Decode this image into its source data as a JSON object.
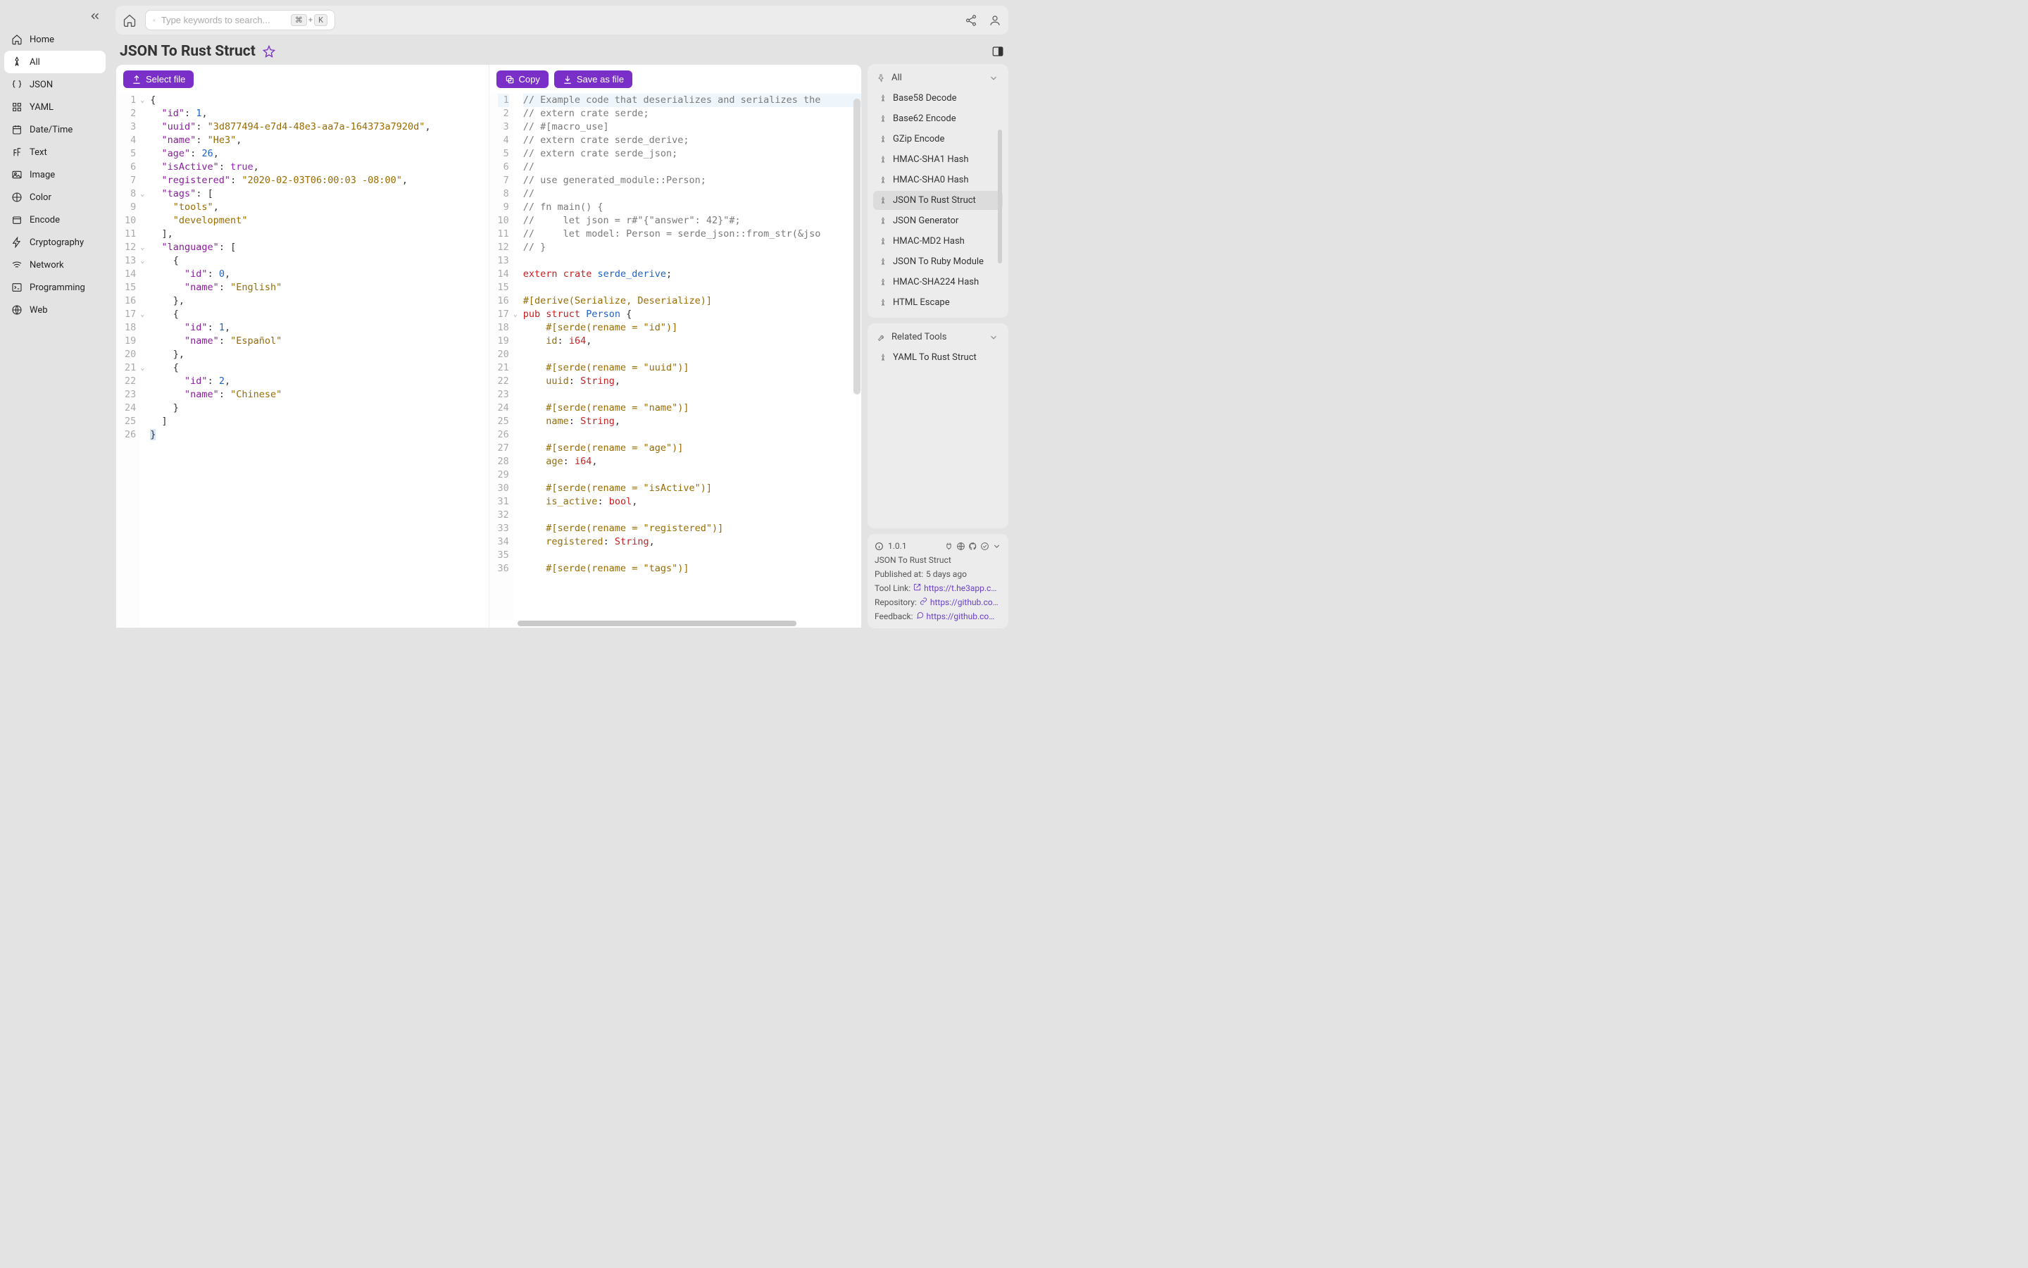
{
  "sidebar": {
    "items": [
      {
        "icon": "home",
        "label": "Home"
      },
      {
        "icon": "pin",
        "label": "All",
        "active": true
      },
      {
        "icon": "braces",
        "label": "JSON"
      },
      {
        "icon": "grid",
        "label": "YAML"
      },
      {
        "icon": "calendar",
        "label": "Date/Time"
      },
      {
        "icon": "font",
        "label": "Text"
      },
      {
        "icon": "image",
        "label": "Image"
      },
      {
        "icon": "palette",
        "label": "Color"
      },
      {
        "icon": "box",
        "label": "Encode"
      },
      {
        "icon": "bolt",
        "label": "Cryptography"
      },
      {
        "icon": "wifi",
        "label": "Network"
      },
      {
        "icon": "terminal",
        "label": "Programming"
      },
      {
        "icon": "globe",
        "label": "Web"
      }
    ]
  },
  "search": {
    "placeholder": "Type keywords to search...",
    "kbd1": "⌘",
    "plus": "+",
    "kbd2": "K"
  },
  "title": "JSON To Rust Struct",
  "left_toolbar": {
    "select_file": "Select file"
  },
  "right_toolbar": {
    "copy": "Copy",
    "save_as": "Save as file"
  },
  "input_json": [
    {
      "n": 1,
      "fold": "v",
      "tokens": [
        {
          "t": "{",
          "c": "p",
          "hl": true
        }
      ]
    },
    {
      "n": 2,
      "tokens": [
        {
          "t": "  ",
          "c": "p"
        },
        {
          "t": "\"id\"",
          "c": "k"
        },
        {
          "t": ": ",
          "c": "p"
        },
        {
          "t": "1",
          "c": "n"
        },
        {
          "t": ",",
          "c": "p"
        }
      ]
    },
    {
      "n": 3,
      "tokens": [
        {
          "t": "  ",
          "c": "p"
        },
        {
          "t": "\"uuid\"",
          "c": "k"
        },
        {
          "t": ": ",
          "c": "p"
        },
        {
          "t": "\"3d877494-e7d4-48e3-aa7a-164373a7920d\"",
          "c": "s"
        },
        {
          "t": ",",
          "c": "p"
        }
      ]
    },
    {
      "n": 4,
      "tokens": [
        {
          "t": "  ",
          "c": "p"
        },
        {
          "t": "\"name\"",
          "c": "k"
        },
        {
          "t": ": ",
          "c": "p"
        },
        {
          "t": "\"He3\"",
          "c": "s"
        },
        {
          "t": ",",
          "c": "p"
        }
      ]
    },
    {
      "n": 5,
      "tokens": [
        {
          "t": "  ",
          "c": "p"
        },
        {
          "t": "\"age\"",
          "c": "k"
        },
        {
          "t": ": ",
          "c": "p"
        },
        {
          "t": "26",
          "c": "n"
        },
        {
          "t": ",",
          "c": "p"
        }
      ]
    },
    {
      "n": 6,
      "tokens": [
        {
          "t": "  ",
          "c": "p"
        },
        {
          "t": "\"isActive\"",
          "c": "k"
        },
        {
          "t": ": ",
          "c": "p"
        },
        {
          "t": "true",
          "c": "b"
        },
        {
          "t": ",",
          "c": "p"
        }
      ]
    },
    {
      "n": 7,
      "tokens": [
        {
          "t": "  ",
          "c": "p"
        },
        {
          "t": "\"registered\"",
          "c": "k"
        },
        {
          "t": ": ",
          "c": "p"
        },
        {
          "t": "\"2020-02-03T06:00:03 -08:00\"",
          "c": "s"
        },
        {
          "t": ",",
          "c": "p"
        }
      ]
    },
    {
      "n": 8,
      "fold": "v",
      "tokens": [
        {
          "t": "  ",
          "c": "p"
        },
        {
          "t": "\"tags\"",
          "c": "k"
        },
        {
          "t": ": [",
          "c": "p"
        }
      ]
    },
    {
      "n": 9,
      "tokens": [
        {
          "t": "    ",
          "c": "p"
        },
        {
          "t": "\"tools\"",
          "c": "s"
        },
        {
          "t": ",",
          "c": "p"
        }
      ]
    },
    {
      "n": 10,
      "tokens": [
        {
          "t": "    ",
          "c": "p"
        },
        {
          "t": "\"development\"",
          "c": "s"
        }
      ]
    },
    {
      "n": 11,
      "tokens": [
        {
          "t": "  ],",
          "c": "p"
        }
      ]
    },
    {
      "n": 12,
      "fold": "v",
      "tokens": [
        {
          "t": "  ",
          "c": "p"
        },
        {
          "t": "\"language\"",
          "c": "k"
        },
        {
          "t": ": [",
          "c": "p"
        }
      ]
    },
    {
      "n": 13,
      "fold": "v",
      "tokens": [
        {
          "t": "    {",
          "c": "p"
        }
      ]
    },
    {
      "n": 14,
      "tokens": [
        {
          "t": "      ",
          "c": "p"
        },
        {
          "t": "\"id\"",
          "c": "k"
        },
        {
          "t": ": ",
          "c": "p"
        },
        {
          "t": "0",
          "c": "n"
        },
        {
          "t": ",",
          "c": "p"
        }
      ]
    },
    {
      "n": 15,
      "tokens": [
        {
          "t": "      ",
          "c": "p"
        },
        {
          "t": "\"name\"",
          "c": "k"
        },
        {
          "t": ": ",
          "c": "p"
        },
        {
          "t": "\"English\"",
          "c": "s"
        }
      ]
    },
    {
      "n": 16,
      "tokens": [
        {
          "t": "    },",
          "c": "p"
        }
      ]
    },
    {
      "n": 17,
      "fold": "v",
      "tokens": [
        {
          "t": "    {",
          "c": "p"
        }
      ]
    },
    {
      "n": 18,
      "tokens": [
        {
          "t": "      ",
          "c": "p"
        },
        {
          "t": "\"id\"",
          "c": "k"
        },
        {
          "t": ": ",
          "c": "p"
        },
        {
          "t": "1",
          "c": "n"
        },
        {
          "t": ",",
          "c": "p"
        }
      ]
    },
    {
      "n": 19,
      "tokens": [
        {
          "t": "      ",
          "c": "p"
        },
        {
          "t": "\"name\"",
          "c": "k"
        },
        {
          "t": ": ",
          "c": "p"
        },
        {
          "t": "\"Español\"",
          "c": "s"
        }
      ]
    },
    {
      "n": 20,
      "tokens": [
        {
          "t": "    },",
          "c": "p"
        }
      ]
    },
    {
      "n": 21,
      "fold": "v",
      "tokens": [
        {
          "t": "    {",
          "c": "p"
        }
      ]
    },
    {
      "n": 22,
      "tokens": [
        {
          "t": "      ",
          "c": "p"
        },
        {
          "t": "\"id\"",
          "c": "k"
        },
        {
          "t": ": ",
          "c": "p"
        },
        {
          "t": "2",
          "c": "n"
        },
        {
          "t": ",",
          "c": "p"
        }
      ]
    },
    {
      "n": 23,
      "tokens": [
        {
          "t": "      ",
          "c": "p"
        },
        {
          "t": "\"name\"",
          "c": "k"
        },
        {
          "t": ": ",
          "c": "p"
        },
        {
          "t": "\"Chinese\"",
          "c": "s"
        }
      ]
    },
    {
      "n": 24,
      "tokens": [
        {
          "t": "    }",
          "c": "p"
        }
      ]
    },
    {
      "n": 25,
      "tokens": [
        {
          "t": "  ]",
          "c": "p"
        }
      ]
    },
    {
      "n": 26,
      "tokens": [
        {
          "t": "}",
          "c": "p",
          "hlbox": true
        }
      ]
    }
  ],
  "output_rust": [
    {
      "n": 1,
      "hl": true,
      "tokens": [
        {
          "t": "// Example code that deserializes and serializes the",
          "c": "c"
        }
      ]
    },
    {
      "n": 2,
      "tokens": [
        {
          "t": "// extern crate serde;",
          "c": "c"
        }
      ]
    },
    {
      "n": 3,
      "tokens": [
        {
          "t": "// #[macro_use]",
          "c": "c"
        }
      ]
    },
    {
      "n": 4,
      "tokens": [
        {
          "t": "// extern crate serde_derive;",
          "c": "c"
        }
      ]
    },
    {
      "n": 5,
      "tokens": [
        {
          "t": "// extern crate serde_json;",
          "c": "c"
        }
      ]
    },
    {
      "n": 6,
      "tokens": [
        {
          "t": "//",
          "c": "c"
        }
      ]
    },
    {
      "n": 7,
      "tokens": [
        {
          "t": "// use generated_module::Person;",
          "c": "c"
        }
      ]
    },
    {
      "n": 8,
      "tokens": [
        {
          "t": "//",
          "c": "c"
        }
      ]
    },
    {
      "n": 9,
      "tokens": [
        {
          "t": "// fn main() {",
          "c": "c"
        }
      ]
    },
    {
      "n": 10,
      "tokens": [
        {
          "t": "//     let json = r#\"{\"answer\": 42}\"#;",
          "c": "c"
        }
      ]
    },
    {
      "n": 11,
      "tokens": [
        {
          "t": "//     let model: Person = serde_json::from_str(&jso",
          "c": "c"
        }
      ]
    },
    {
      "n": 12,
      "tokens": [
        {
          "t": "// }",
          "c": "c"
        }
      ]
    },
    {
      "n": 13,
      "tokens": [
        {
          "t": "",
          "c": "p"
        }
      ]
    },
    {
      "n": 14,
      "tokens": [
        {
          "t": "extern",
          "c": "kw"
        },
        {
          "t": " ",
          "c": "p"
        },
        {
          "t": "crate",
          "c": "kw"
        },
        {
          "t": " ",
          "c": "p"
        },
        {
          "t": "serde_derive",
          "c": "ty"
        },
        {
          "t": ";",
          "c": "p"
        }
      ]
    },
    {
      "n": 15,
      "tokens": [
        {
          "t": "",
          "c": "p"
        }
      ]
    },
    {
      "n": 16,
      "tokens": [
        {
          "t": "#[derive(Serialize, Deserialize)]",
          "c": "at"
        }
      ]
    },
    {
      "n": 17,
      "fold": "v",
      "tokens": [
        {
          "t": "pub",
          "c": "kw"
        },
        {
          "t": " ",
          "c": "p"
        },
        {
          "t": "struct",
          "c": "kw"
        },
        {
          "t": " ",
          "c": "p"
        },
        {
          "t": "Person",
          "c": "ty"
        },
        {
          "t": " {",
          "c": "p"
        }
      ]
    },
    {
      "n": 18,
      "tokens": [
        {
          "t": "    #[serde(rename = \"id\")]",
          "c": "at"
        }
      ]
    },
    {
      "n": 19,
      "tokens": [
        {
          "t": "    ",
          "c": "p"
        },
        {
          "t": "id",
          "c": "id"
        },
        {
          "t": ": ",
          "c": "p"
        },
        {
          "t": "i64",
          "c": "kw"
        },
        {
          "t": ",",
          "c": "p"
        }
      ]
    },
    {
      "n": 20,
      "tokens": [
        {
          "t": "",
          "c": "p"
        }
      ]
    },
    {
      "n": 21,
      "tokens": [
        {
          "t": "    #[serde(rename = \"uuid\")]",
          "c": "at"
        }
      ]
    },
    {
      "n": 22,
      "tokens": [
        {
          "t": "    ",
          "c": "p"
        },
        {
          "t": "uuid",
          "c": "id"
        },
        {
          "t": ": ",
          "c": "p"
        },
        {
          "t": "String",
          "c": "kw"
        },
        {
          "t": ",",
          "c": "p"
        }
      ]
    },
    {
      "n": 23,
      "tokens": [
        {
          "t": "",
          "c": "p"
        }
      ]
    },
    {
      "n": 24,
      "tokens": [
        {
          "t": "    #[serde(rename = \"name\")]",
          "c": "at"
        }
      ]
    },
    {
      "n": 25,
      "tokens": [
        {
          "t": "    ",
          "c": "p"
        },
        {
          "t": "name",
          "c": "id"
        },
        {
          "t": ": ",
          "c": "p"
        },
        {
          "t": "String",
          "c": "kw"
        },
        {
          "t": ",",
          "c": "p"
        }
      ]
    },
    {
      "n": 26,
      "tokens": [
        {
          "t": "",
          "c": "p"
        }
      ]
    },
    {
      "n": 27,
      "tokens": [
        {
          "t": "    #[serde(rename = \"age\")]",
          "c": "at"
        }
      ]
    },
    {
      "n": 28,
      "tokens": [
        {
          "t": "    ",
          "c": "p"
        },
        {
          "t": "age",
          "c": "id"
        },
        {
          "t": ": ",
          "c": "p"
        },
        {
          "t": "i64",
          "c": "kw"
        },
        {
          "t": ",",
          "c": "p"
        }
      ]
    },
    {
      "n": 29,
      "tokens": [
        {
          "t": "",
          "c": "p"
        }
      ]
    },
    {
      "n": 30,
      "tokens": [
        {
          "t": "    #[serde(rename = \"isActive\")]",
          "c": "at"
        }
      ]
    },
    {
      "n": 31,
      "tokens": [
        {
          "t": "    ",
          "c": "p"
        },
        {
          "t": "is_active",
          "c": "id"
        },
        {
          "t": ": ",
          "c": "p"
        },
        {
          "t": "bool",
          "c": "kw"
        },
        {
          "t": ",",
          "c": "p"
        }
      ]
    },
    {
      "n": 32,
      "tokens": [
        {
          "t": "",
          "c": "p"
        }
      ]
    },
    {
      "n": 33,
      "tokens": [
        {
          "t": "    #[serde(rename = \"registered\")]",
          "c": "at"
        }
      ]
    },
    {
      "n": 34,
      "tokens": [
        {
          "t": "    ",
          "c": "p"
        },
        {
          "t": "registered",
          "c": "id"
        },
        {
          "t": ": ",
          "c": "p"
        },
        {
          "t": "String",
          "c": "kw"
        },
        {
          "t": ",",
          "c": "p"
        }
      ]
    },
    {
      "n": 35,
      "tokens": [
        {
          "t": "",
          "c": "p"
        }
      ]
    },
    {
      "n": 36,
      "tokens": [
        {
          "t": "    #[serde(rename = \"tags\")]",
          "c": "at"
        }
      ]
    }
  ],
  "rail": {
    "all_header": "All",
    "items": [
      "Base58 Decode",
      "Base62 Encode",
      "GZip Encode",
      "HMAC-SHA1 Hash",
      "HMAC-SHA0 Hash",
      "JSON To Rust Struct",
      "JSON Generator",
      "HMAC-MD2 Hash",
      "JSON To Ruby Module",
      "HMAC-SHA224 Hash",
      "HTML Escape"
    ],
    "active_index": 5,
    "related_header": "Related Tools",
    "related_items": [
      "YAML To Rust Struct"
    ]
  },
  "info": {
    "version": "1.0.1",
    "name": "JSON To Rust Struct",
    "published_label": "Published at:",
    "published_value": "5 days ago",
    "tool_link_label": "Tool Link:",
    "tool_link": "https://t.he3app.co…",
    "repo_label": "Repository:",
    "repo_link": "https://github.com…",
    "feedback_label": "Feedback:",
    "feedback_link": "https://github.com/…"
  }
}
